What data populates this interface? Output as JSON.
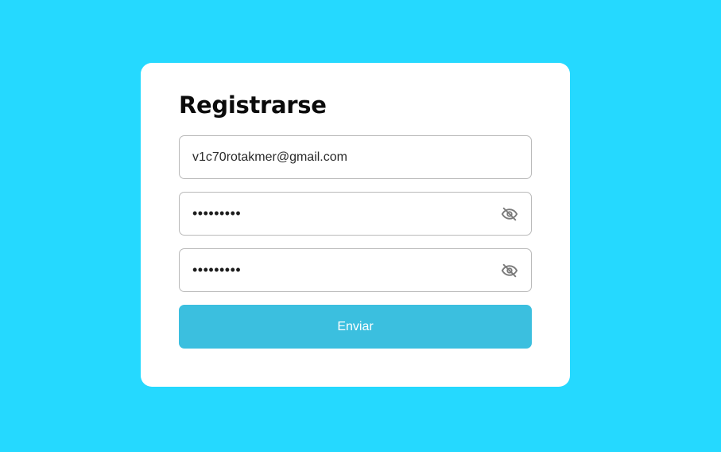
{
  "form": {
    "title": "Registrarse",
    "email_value": "v1c70rotakmer@gmail.com",
    "password_value": "•••••••••",
    "confirm_password_value": "•••••••••",
    "submit_label": "Enviar"
  },
  "icons": {
    "password_toggle": "eye-off-icon",
    "confirm_toggle": "eye-off-icon"
  },
  "colors": {
    "background": "#25d9ff",
    "card": "#ffffff",
    "button": "#3bbfdf",
    "icon": "#7a7a7a"
  }
}
